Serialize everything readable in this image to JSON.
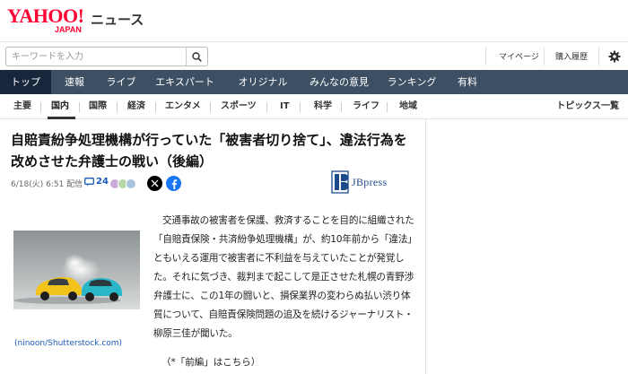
{
  "header": {
    "logo_main": "YAHOO!",
    "logo_sub": "JAPAN",
    "section": "ニュース"
  },
  "search": {
    "placeholder": "キーワードを入力",
    "mypage": "マイページ",
    "history": "購入履歴"
  },
  "global_nav": [
    "トップ",
    "速報",
    "ライブ",
    "エキスパート",
    "オリジナル",
    "みんなの意見",
    "ランキング",
    "有料"
  ],
  "category_nav": [
    "主要",
    "国内",
    "国際",
    "経済",
    "エンタメ",
    "スポーツ",
    "IT",
    "科学",
    "ライフ",
    "地域"
  ],
  "topics_label": "トピックス一覧",
  "article": {
    "title": "自賠責紛争処理機構が行っていた「被害者切り捨て」、違法行為を改めさせた弁護士の戦い（後編）",
    "date": "6/18(火) 6:51 配信",
    "comment_count": "24",
    "publisher": "JBpress",
    "photo_credit": "(ninoon/Shutterstock.com)",
    "body": "交通事故の被害者を保護、救済することを目的に組織された「自賠責保険・共済紛争処理機構」が、約10年前から「違法」ともいえる運用で被害者に不利益を与えていたことが発覚した。それに気づき、裁判まで起こして是正させた札幌の青野渉弁護士に、この1年の闘いと、損保業界の変わらぬ払い渋り体質について、自賠責保険問題の追及を続けるジャーナリスト・柳原三佳が聞いた。",
    "prev_link": "（*「前編」はこちら）"
  },
  "colors": {
    "brand_red": "#ff0033",
    "nav_bg": "#3d4f63",
    "nav_active": "#17263a",
    "link_blue": "#1a5bb5",
    "facebook": "#1877f2"
  }
}
